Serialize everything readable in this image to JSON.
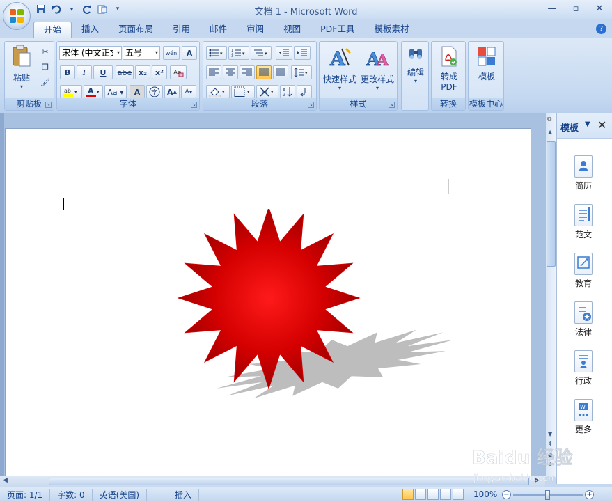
{
  "window": {
    "title": "文档 1 - Microsoft Word",
    "minimize_icon": "minimize-icon",
    "restore_icon": "restore-icon",
    "close_icon": "close-icon"
  },
  "tabs": [
    "开始",
    "插入",
    "页面布局",
    "引用",
    "邮件",
    "审阅",
    "视图",
    "PDF工具",
    "模板素材"
  ],
  "ribbon": {
    "clipboard": {
      "paste": "粘贴",
      "label": "剪贴板"
    },
    "font": {
      "font_name": "宋体 (中文正文)",
      "font_size": "五号",
      "label": "字体",
      "bold": "B",
      "italic": "I",
      "underline": "U",
      "strike": "abe",
      "sub": "x₂",
      "sup": "x²",
      "case": "Aa",
      "grow": "A",
      "shrink": "A",
      "phonetic": "wén",
      "border_char": "A",
      "shade_char": "A",
      "enclose": "字"
    },
    "paragraph": {
      "label": "段落"
    },
    "styles": {
      "quick": "快速样式",
      "change": "更改样式",
      "label": "样式"
    },
    "editing": {
      "edit": "编辑"
    },
    "convert": {
      "pdf": "转成",
      "pdf2": "PDF",
      "label": "转换"
    },
    "template_center": {
      "template": "模板",
      "label": "模板中心"
    }
  },
  "task_pane": {
    "title": "模板",
    "items": [
      "简历",
      "范文",
      "教育",
      "法律",
      "行政",
      "更多"
    ]
  },
  "status": {
    "page": "页面: 1/1",
    "words": "字数: 0",
    "language": "英语(美国)",
    "mode": "插入",
    "zoom": "100%"
  },
  "watermark": {
    "line1": "Baidu 经验",
    "line2": "jingyan.baidu.com"
  },
  "colors": {
    "starburst": "#d00000",
    "shadow": "#bdbdbd",
    "ribbon_bg": "#c4d8f1",
    "accent": "#15428b"
  }
}
